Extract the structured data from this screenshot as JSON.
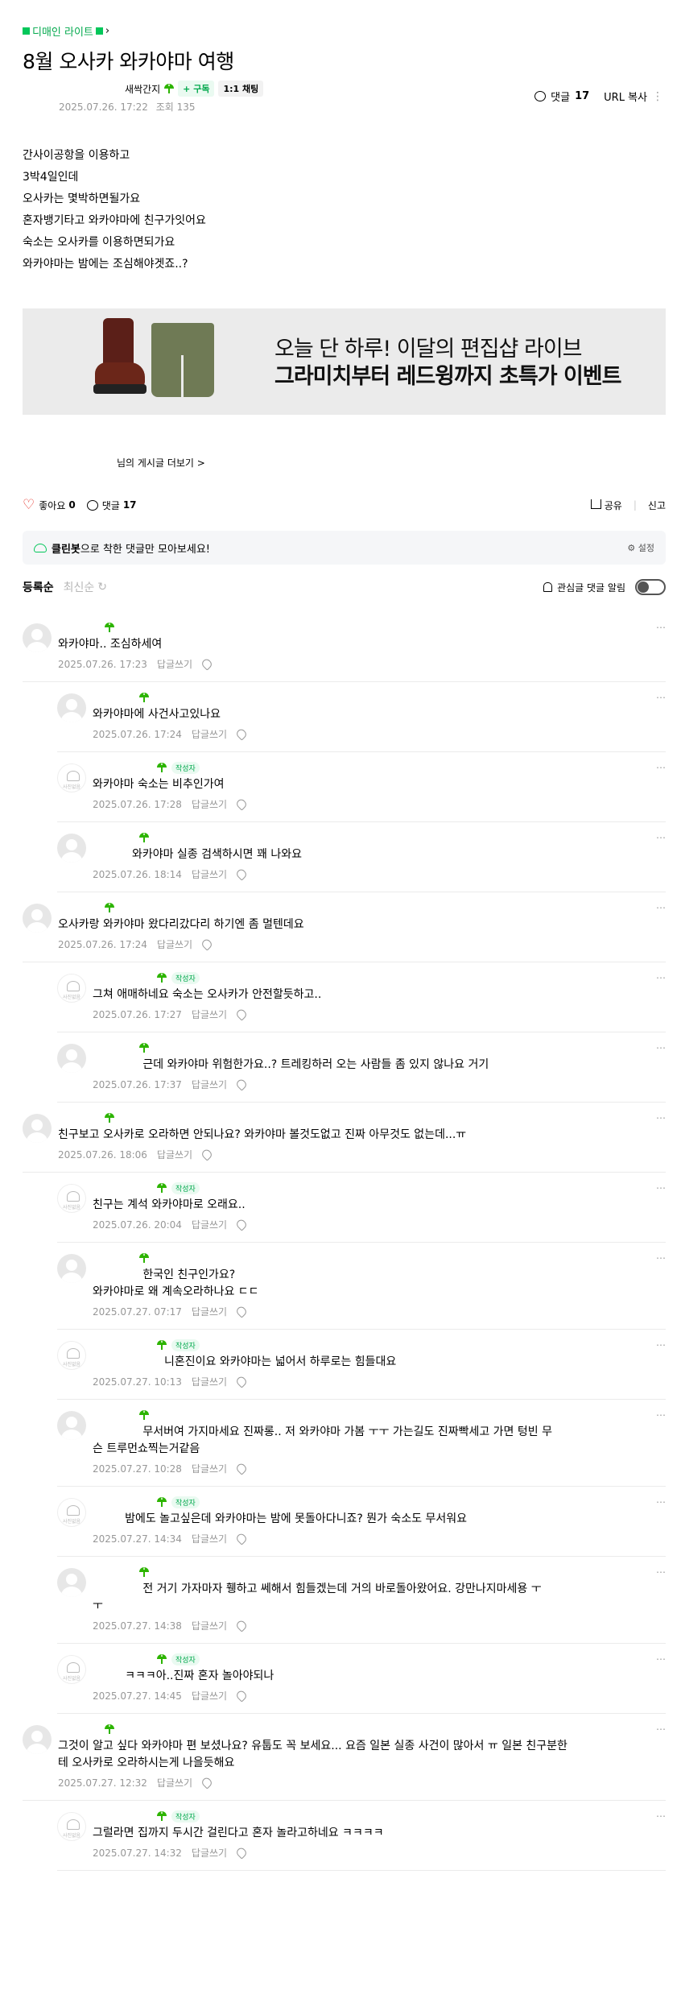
{
  "cafe": {
    "name": "디매인 라이트"
  },
  "post": {
    "title": "8월 오사카 와카야마 여행",
    "writer_btn_subscribe": "+ 구독",
    "writer_btn_chat": "1:1 채팅",
    "date": "2025.07.26. 17:22",
    "views": "조회 135",
    "writer": "새싹간지",
    "comment_label": "댓글",
    "comment_count": "17",
    "url_copy": "URL 복사",
    "body_lines": [
      "간사이공항을 이용하고",
      "3박4일인데",
      "오사카는 몇박하면될가요",
      "혼자뱅기타고 와카야마에 친구가잇어요",
      "숙소는 오사카를 이용하면되가요",
      "와카야마는 밤에는 조심해야겟죠..?"
    ]
  },
  "banner": {
    "line1": "오늘 단 하루! 이달의 편집샵 라이브",
    "line2": "그라미치부터 레드윙까지 초특가 이벤트"
  },
  "more_posts": "님의 게시글 더보기 >",
  "actions": {
    "like_label": "좋아요",
    "like_count": "0",
    "comment_label": "댓글",
    "comment_count": "17",
    "share": "공유",
    "report": "신고"
  },
  "cleanbot": {
    "brand": "클린봇",
    "text": "으로 착한 댓글만 모아보세요!",
    "setting": "설정"
  },
  "sort": {
    "active": "등록순",
    "inactive": "최신순",
    "alert": "관심글 댓글 알림"
  },
  "comment_ui": {
    "reply": "답글쓰기",
    "writer_badge": "작성자"
  },
  "comments": [
    {
      "reply": false,
      "author": false,
      "text": "와카야마.. 조심하세여",
      "date": "2025.07.26. 17:23"
    },
    {
      "reply": true,
      "author": false,
      "text": "와카야마에 사건사고있나요",
      "date": "2025.07.26. 17:24"
    },
    {
      "reply": true,
      "author": true,
      "text": "와카야마 숙소는 비추인가여",
      "date": "2025.07.26. 17:28"
    },
    {
      "reply": true,
      "author": false,
      "text": "           와카야마 실종 검색하시면 꽤 나와요",
      "date": "2025.07.26. 18:14"
    },
    {
      "reply": false,
      "author": false,
      "text": "오사카랑 와카야마 왔다리갔다리 하기엔 좀 멀텐데요",
      "date": "2025.07.26. 17:24"
    },
    {
      "reply": true,
      "author": true,
      "text": "그쳐 애매하네요 숙소는 오사카가 안전할듯하고..",
      "date": "2025.07.26. 17:27"
    },
    {
      "reply": true,
      "author": false,
      "text": "              근데 와카야마 위험한가요..? 트레킹하러 오는 사람들 좀 있지 않나요 거기",
      "date": "2025.07.26. 17:37"
    },
    {
      "reply": false,
      "author": false,
      "text": "친구보고 오사카로 오라하면 안되나요? 와카야마 볼것도없고 진짜 아무것도 없는데...ㅠ",
      "date": "2025.07.26. 18:06"
    },
    {
      "reply": true,
      "author": true,
      "text": "친구는 계석 와카야마로 오래요..",
      "date": "2025.07.26. 20:04"
    },
    {
      "reply": true,
      "author": false,
      "text": "              한국인 친구인가요?\n와카야마로 왜 계속오라하나요 ㄷㄷ",
      "date": "2025.07.27. 07:17"
    },
    {
      "reply": true,
      "author": true,
      "text": "                    니혼진이요 와카야마는 넓어서 하루로는 힘들대요",
      "date": "2025.07.27. 10:13"
    },
    {
      "reply": true,
      "author": false,
      "text": "              무서버여 가지마세요 진짜롱.. 저 와카야마 가봄 ㅜㅜ 가는길도 진짜빡세고 가면 텅빈 무\n슨 트루먼쇼찍는거같음",
      "date": "2025.07.27. 10:28"
    },
    {
      "reply": true,
      "author": true,
      "text": "         밤에도 놀고싶은데 와카야마는 밤에 못돌아다니죠? 뭔가 숙소도 무서워요",
      "date": "2025.07.27. 14:34"
    },
    {
      "reply": true,
      "author": false,
      "text": "              전 거기 가자마자 휑하고 쎄해서 힘들겠는데 거의 바로돌아왔어요. 강만나지마세용 ㅜ\nㅜ",
      "date": "2025.07.27. 14:38"
    },
    {
      "reply": true,
      "author": true,
      "text": "         ㅋㅋㅋ아..진짜 혼자 놀아야되나",
      "date": "2025.07.27. 14:45"
    },
    {
      "reply": false,
      "author": false,
      "text": "그것이 알고 싶다 와카야마 편 보셨나요? 유툽도 꼭 보세요... 요즘 일본 실종 사건이 많아서 ㅠ 일본 친구분한\n테 오사카로 오라하시는게 나을듯해요",
      "date": "2025.07.27. 12:32"
    },
    {
      "reply": true,
      "author": true,
      "text": "그럴라면 집까지 두시간 걸린다고 혼자 놀라고하네요 ㅋㅋㅋㅋ",
      "date": "2025.07.27. 14:32"
    }
  ]
}
